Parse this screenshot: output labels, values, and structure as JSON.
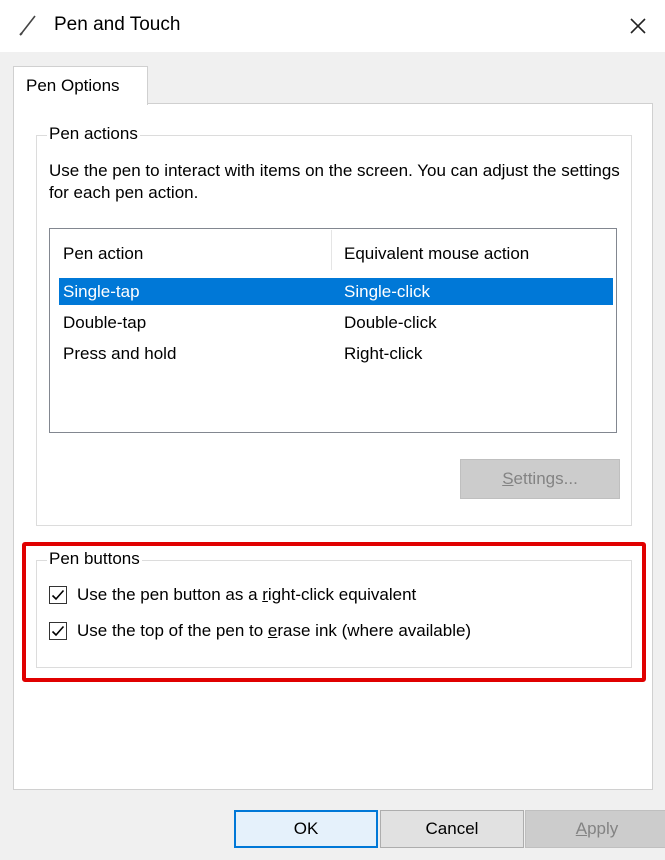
{
  "window": {
    "title": "Pen and Touch"
  },
  "tabs": [
    {
      "label": "Pen Options"
    }
  ],
  "pen_actions": {
    "group_title": "Pen actions",
    "description": "Use the pen to interact with items on the screen.  You can adjust the settings for each pen action.",
    "columns": [
      "Pen action",
      "Equivalent mouse action"
    ],
    "rows": [
      {
        "action": "Single-tap",
        "mouse": "Single-click",
        "selected": true
      },
      {
        "action": "Double-tap",
        "mouse": "Double-click",
        "selected": false
      },
      {
        "action": "Press and hold",
        "mouse": "Right-click",
        "selected": false
      }
    ],
    "settings_button": {
      "pre": "",
      "accel": "S",
      "post": "ettings..."
    }
  },
  "pen_buttons": {
    "group_title": "Pen buttons",
    "options": [
      {
        "pre": "Use the pen button as a ",
        "accel": "r",
        "post": "ight-click equivalent",
        "checked": true
      },
      {
        "pre": "Use the top of the pen to ",
        "accel": "e",
        "post": "rase ink (where available)",
        "checked": true
      }
    ]
  },
  "footer": {
    "ok": "OK",
    "cancel": "Cancel",
    "apply": {
      "pre": "",
      "accel": "A",
      "post": "pply"
    }
  },
  "colors": {
    "selection": "#0078d7",
    "highlight": "#e00000"
  },
  "icons": {
    "title": "pen-icon",
    "close": "close-icon",
    "check": "checkmark-icon"
  }
}
